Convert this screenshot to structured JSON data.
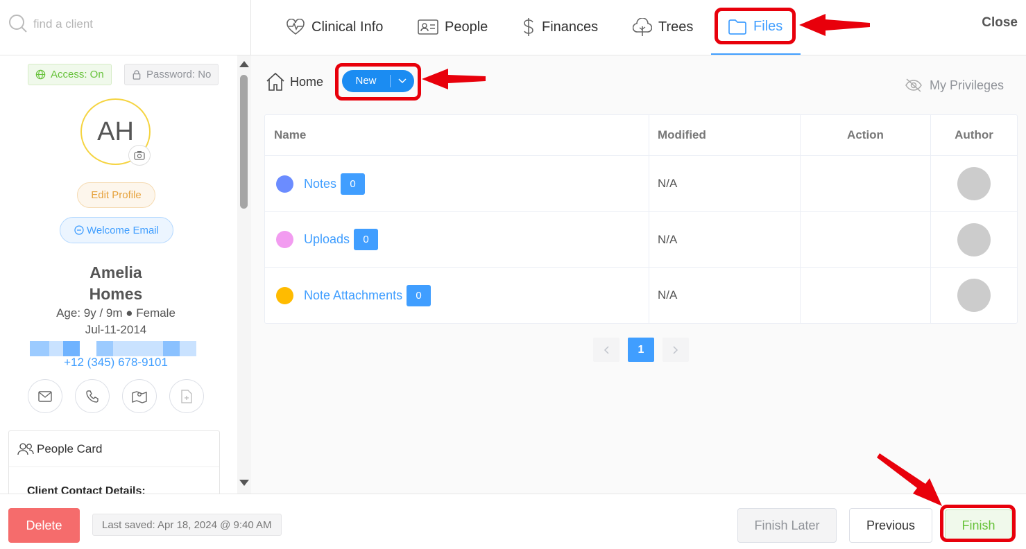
{
  "search": {
    "placeholder": "find a client"
  },
  "profile": {
    "access": "Access: On",
    "password": "Password: No",
    "initials": "AH",
    "edit_profile": "Edit Profile",
    "welcome_email": "Welcome Email",
    "first_name": "Amelia",
    "last_name": "Homes",
    "age_line": "Age: 9y / 9m ● Female",
    "dob": "Jul-11-2014",
    "phone": "+12 (345) 678-9101"
  },
  "people_card": {
    "title": "People Card",
    "subtitle": "Client Contact Details:"
  },
  "nav": {
    "tabs": [
      {
        "label": "Clinical Info",
        "icon": "heartbeat-icon"
      },
      {
        "label": "People",
        "icon": "id-card-icon"
      },
      {
        "label": "Finances",
        "icon": "dollar-icon"
      },
      {
        "label": "Trees",
        "icon": "tree-icon"
      },
      {
        "label": "Files",
        "icon": "folder-icon",
        "active": true
      }
    ],
    "close": "Close"
  },
  "toolbar": {
    "home": "Home",
    "new": "New",
    "privileges": "My Privileges"
  },
  "table": {
    "columns": [
      "Name",
      "Modified",
      "Action",
      "Author"
    ],
    "rows": [
      {
        "name": "Notes",
        "count": "0",
        "modified": "N/A",
        "color": "#6b8cff"
      },
      {
        "name": "Uploads",
        "count": "0",
        "modified": "N/A",
        "color": "#f29cf0"
      },
      {
        "name": "Note Attachments",
        "count": "0",
        "modified": "N/A",
        "color": "#ffbb00"
      }
    ]
  },
  "pagination": {
    "current": "1"
  },
  "footer": {
    "delete": "Delete",
    "last_saved": "Last saved: Apr 18, 2024 @ 9:40 AM",
    "finish_later": "Finish Later",
    "previous": "Previous",
    "finish": "Finish"
  },
  "colors": {
    "accent": "#409eff",
    "annotation": "#e8000b",
    "danger": "#f56c6c",
    "success": "#67c23a"
  }
}
